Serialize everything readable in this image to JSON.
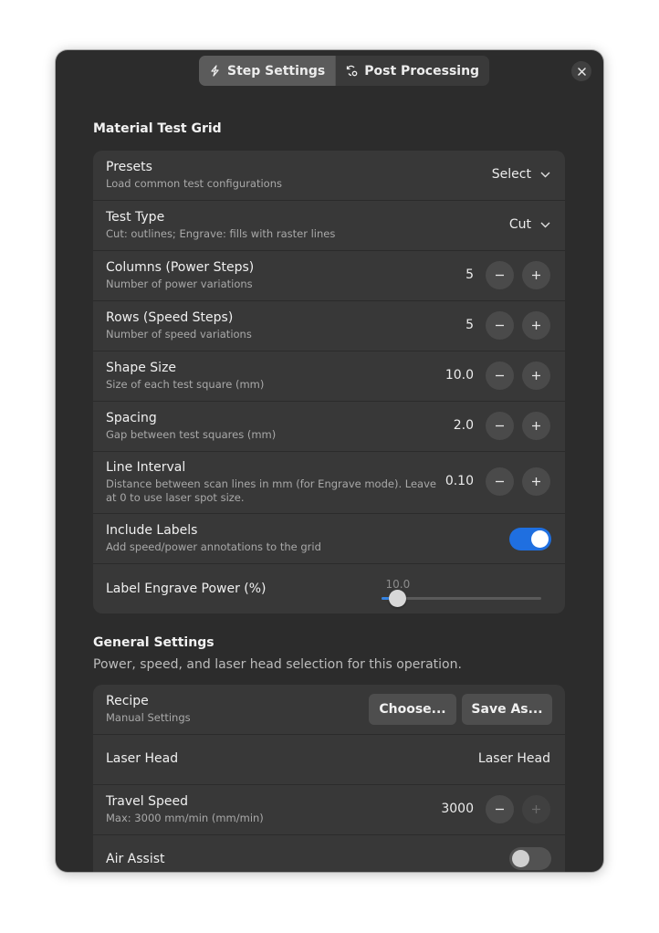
{
  "tabs": [
    {
      "label": "Step Settings",
      "icon": "step-icon",
      "active": true
    },
    {
      "label": "Post Processing",
      "icon": "post-processing-icon",
      "active": false
    }
  ],
  "close_icon": "close-icon",
  "material": {
    "title": "Material Test Grid",
    "presets": {
      "title": "Presets",
      "subtitle": "Load common test configurations",
      "value": "Select"
    },
    "test_type": {
      "title": "Test Type",
      "subtitle": "Cut: outlines; Engrave: fills with raster lines",
      "value": "Cut"
    },
    "columns": {
      "title": "Columns (Power Steps)",
      "subtitle": "Number of power variations",
      "value": "5"
    },
    "rows": {
      "title": "Rows (Speed Steps)",
      "subtitle": "Number of speed variations",
      "value": "5"
    },
    "shape_size": {
      "title": "Shape Size",
      "subtitle": "Size of each test square (mm)",
      "value": "10.0"
    },
    "spacing": {
      "title": "Spacing",
      "subtitle": "Gap between test squares (mm)",
      "value": "2.0"
    },
    "line_interval": {
      "title": "Line Interval",
      "subtitle": "Distance between scan lines in mm (for Engrave mode). Leave at 0 to use laser spot size.",
      "value": "0.10"
    },
    "include_labels": {
      "title": "Include Labels",
      "subtitle": "Add speed/power annotations to the grid",
      "on": true
    },
    "label_power": {
      "title": "Label Engrave Power (%)",
      "value": "10.0",
      "fraction": 0.1
    }
  },
  "general": {
    "title": "General Settings",
    "description": "Power, speed, and laser head selection for this operation.",
    "recipe": {
      "title": "Recipe",
      "subtitle": "Manual Settings",
      "choose_label": "Choose...",
      "save_label": "Save As..."
    },
    "laser_head": {
      "title": "Laser Head",
      "value": "Laser Head"
    },
    "travel_speed": {
      "title": "Travel Speed",
      "subtitle": "Max: 3000 mm/min (mm/min)",
      "value": "3000"
    },
    "air_assist": {
      "title": "Air Assist",
      "on": false
    }
  },
  "colors": {
    "accent": "#3584e4",
    "switch_on": "#1f6fe0",
    "window_bg": "#2c2c2c",
    "card_bg": "#383838"
  }
}
